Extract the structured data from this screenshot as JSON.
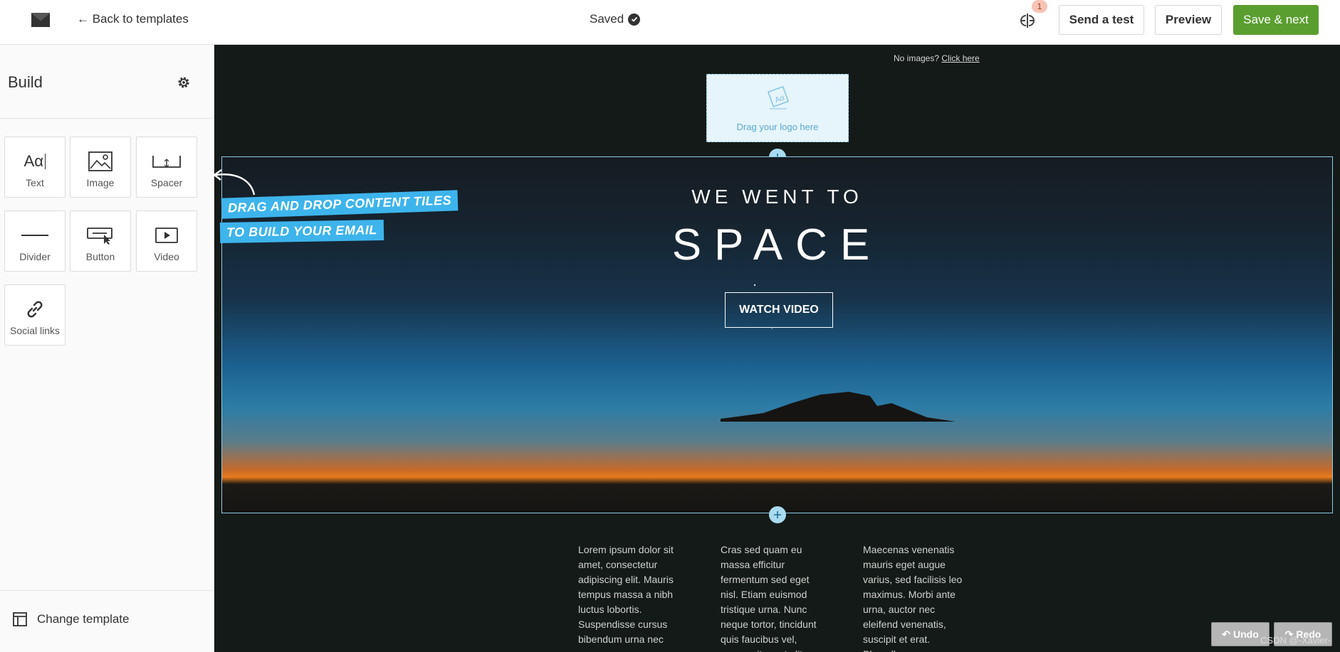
{
  "topbar": {
    "back_label": "← Back to templates",
    "saved_label": "Saved",
    "ab_badge": "1",
    "send_test_label": "Send a test",
    "preview_label": "Preview",
    "save_next_label": "Save & next"
  },
  "sidebar": {
    "title": "Build",
    "tiles": [
      {
        "label": "Text",
        "icon": "text-icon"
      },
      {
        "label": "Image",
        "icon": "image-icon"
      },
      {
        "label": "Spacer",
        "icon": "spacer-icon"
      },
      {
        "label": "Divider",
        "icon": "divider-icon"
      },
      {
        "label": "Button",
        "icon": "button-icon"
      },
      {
        "label": "Video",
        "icon": "video-icon"
      },
      {
        "label": "Social links",
        "icon": "link-icon"
      }
    ],
    "change_template_label": "Change template"
  },
  "callout": {
    "line1": "DRAG AND DROP CONTENT TILES",
    "line2": "TO BUILD YOUR EMAIL"
  },
  "canvas": {
    "no_images_text": "No images?",
    "no_images_link": "Click here",
    "logo_drop_text": "Drag your logo here",
    "hero_subtitle": "WE WENT TO",
    "hero_title": "SPACE",
    "hero_button": "WATCH VIDEO",
    "columns": [
      "Lorem ipsum dolor sit amet, consectetur adipiscing elit. Mauris tempus massa a nibh luctus lobortis. Suspendisse cursus bibendum urna nec",
      "Cras sed quam eu massa efficitur fermentum sed eget nisl. Etiam euismod tristique urna. Nunc neque tortor, tincidunt quis faucibus vel, ornare sit amet elit. Nam congue",
      "Maecenas venenatis mauris eget augue varius, sed facilisis leo maximus. Morbi ante urna, auctor nec eleifend venenatis, suscipit et erat. Phasellus"
    ],
    "undo_label": "Undo",
    "redo_label": "Redo",
    "watermark": "CSDN @-Xavier-"
  }
}
